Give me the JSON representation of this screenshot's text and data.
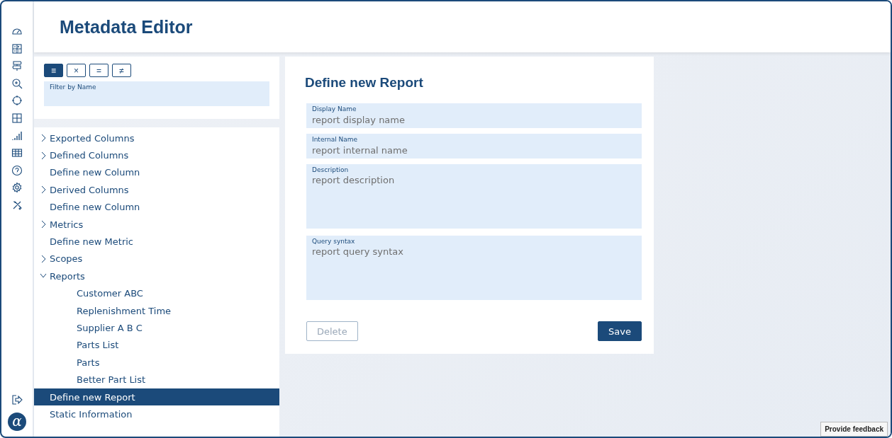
{
  "app": {
    "title": "Metadata Editor",
    "logo": "α"
  },
  "filter": {
    "modes": [
      {
        "glyph": "≡",
        "selected": true
      },
      {
        "glyph": "×",
        "selected": false
      },
      {
        "glyph": "=",
        "selected": false
      },
      {
        "glyph": "≠",
        "selected": false
      }
    ],
    "field": {
      "label": "Filter by Name"
    }
  },
  "tree": [
    {
      "kind": "group",
      "label": "Exported Columns",
      "expanded": false,
      "selected": false
    },
    {
      "kind": "group",
      "label": "Defined Columns",
      "expanded": false,
      "selected": false
    },
    {
      "kind": "link",
      "label": "Define new Column",
      "selected": false
    },
    {
      "kind": "group",
      "label": "Derived Columns",
      "expanded": false,
      "selected": false
    },
    {
      "kind": "link",
      "label": "Define new Column",
      "selected": false
    },
    {
      "kind": "group",
      "label": "Metrics",
      "expanded": false,
      "selected": false
    },
    {
      "kind": "link",
      "label": "Define new Metric",
      "selected": false
    },
    {
      "kind": "group",
      "label": "Scopes",
      "expanded": false,
      "selected": false
    },
    {
      "kind": "group",
      "label": "Reports",
      "expanded": true,
      "selected": false,
      "children": [
        {
          "label": "Customer ABC",
          "selected": false
        },
        {
          "label": "Replenishment Time",
          "selected": false
        },
        {
          "label": "Supplier A B C",
          "selected": false
        },
        {
          "label": "Parts List",
          "selected": false
        },
        {
          "label": "Parts",
          "selected": false
        },
        {
          "label": "Better Part List",
          "selected": false
        }
      ]
    },
    {
      "kind": "link",
      "label": "Define new Report",
      "selected": true
    },
    {
      "kind": "link",
      "label": "Static Information",
      "selected": false
    }
  ],
  "form": {
    "title": "Define new Report",
    "fields": [
      {
        "label": "Display Name",
        "placeholder": "report display name",
        "multiline": false
      },
      {
        "label": "Internal Name",
        "placeholder": "report internal name",
        "multiline": false
      },
      {
        "label": "Description",
        "placeholder": "report description",
        "multiline": true
      },
      {
        "label": "Query syntax",
        "placeholder": "report query syntax",
        "multiline": true
      }
    ],
    "buttons": [
      {
        "kind": "delete",
        "label": "Delete",
        "disabled": true
      },
      {
        "kind": "save",
        "label": "Save",
        "disabled": false
      }
    ]
  },
  "feedback": {
    "label": "Provide feedback"
  }
}
